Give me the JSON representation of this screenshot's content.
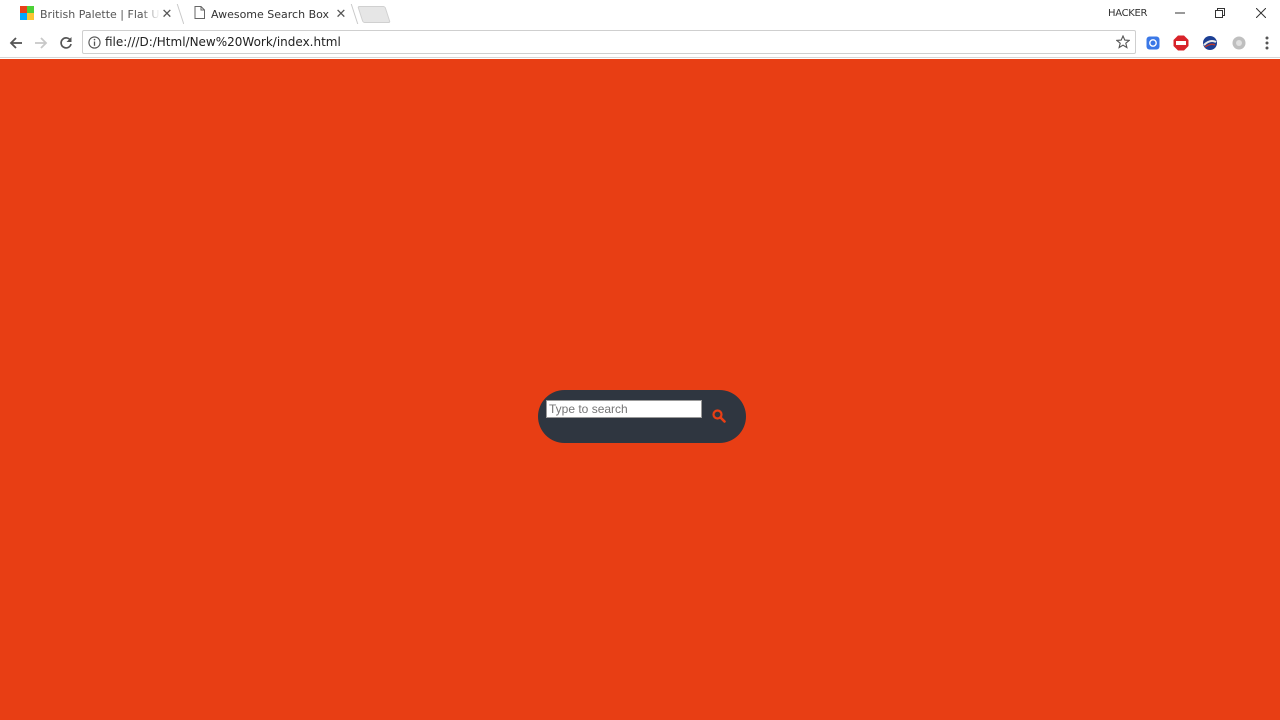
{
  "browser": {
    "tabs": [
      {
        "label": "British Palette | Flat UI",
        "active": false
      },
      {
        "label": "Awesome Search Box",
        "active": true
      }
    ],
    "profile_name": "HACKER",
    "url": "file:///D:/Html/New%20Work/index.html"
  },
  "page": {
    "background_color": "#e83e14",
    "search": {
      "placeholder": "Type to search",
      "value": "",
      "box_color": "#2f3640",
      "icon": "search-icon",
      "icon_color": "#e83e14"
    }
  }
}
